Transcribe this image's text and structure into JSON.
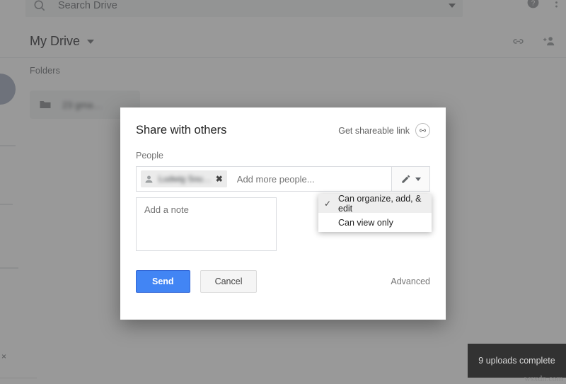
{
  "app": {
    "search": {
      "placeholder": "Search Drive",
      "icon": "search-icon",
      "caret_icon": "chevron-down-icon"
    },
    "top_icons": [
      {
        "name": "help-icon",
        "glyph": "?"
      },
      {
        "name": "settings-icon",
        "glyph": "⋮"
      }
    ],
    "breadcrumb": {
      "title": "My Drive",
      "caret_icon": "chevron-down-icon"
    },
    "drive_actions": [
      {
        "name": "get-link-icon"
      },
      {
        "name": "add-person-icon"
      }
    ],
    "folders_section": {
      "label": "Folders",
      "items": [
        {
          "name": "folder-item",
          "label": "23 gma…",
          "icon": "folder-icon",
          "blurred": true
        }
      ]
    },
    "sidebar": {
      "new_button_icon": "new-fab-circle",
      "close_icon": "×"
    }
  },
  "dialog": {
    "title": "Share with others",
    "shareable_link": {
      "label": "Get shareable link",
      "icon": "link-icon"
    },
    "people": {
      "label": "People",
      "chips": [
        {
          "name": "person-chip",
          "label": "Ludwig Sou…",
          "blurred": true,
          "remove_icon": "✖"
        }
      ],
      "input_placeholder": "Add more people...",
      "permission_button": {
        "icon": "pencil-icon",
        "caret_icon": "chevron-down-icon"
      }
    },
    "note": {
      "placeholder": "Add a note",
      "value": ""
    },
    "footer": {
      "send_label": "Send",
      "cancel_label": "Cancel",
      "advanced_label": "Advanced"
    }
  },
  "permission_menu": {
    "items": [
      {
        "label": "Can organize, add, & edit",
        "selected": true,
        "check_glyph": "✓"
      },
      {
        "label": "Can view only",
        "selected": false,
        "check_glyph": ""
      }
    ]
  },
  "toast": {
    "message": "9 uploads complete"
  },
  "watermark": {
    "text": "wsxdn.com"
  },
  "colors": {
    "accent": "#4285f4",
    "toast_bg": "#323232",
    "chip_bg": "#ebebeb",
    "menu_selected_bg": "#eeeeee"
  }
}
